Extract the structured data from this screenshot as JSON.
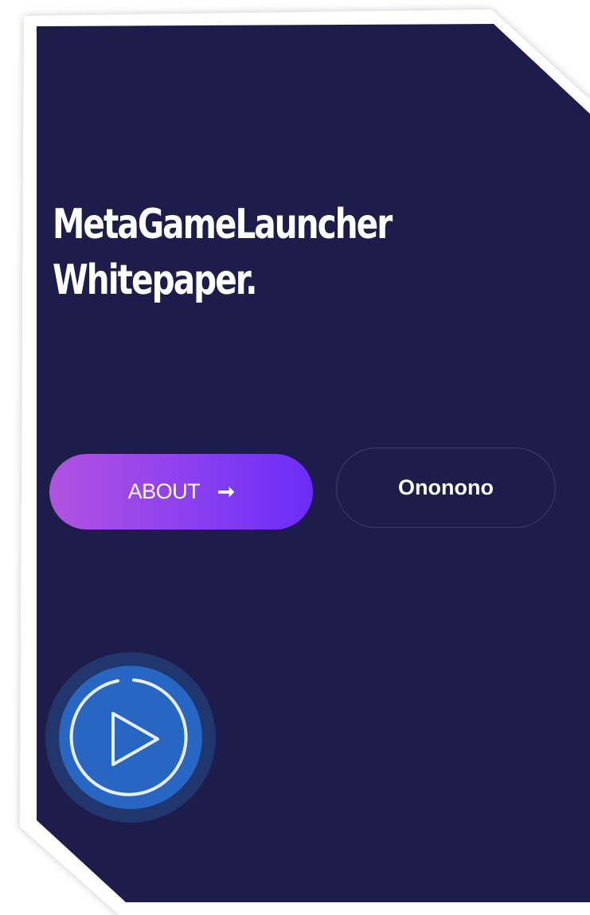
{
  "hero": {
    "title_line1": "MetaGameLauncher",
    "title_line2": "Whitepaper."
  },
  "buttons": {
    "about_label": "ABOUT",
    "about_arrow": "➞",
    "secondary_label": "Ononono"
  },
  "play_button": {
    "icon": "play-icon"
  },
  "colors": {
    "background": "#1e1c4a",
    "frame_border": "#ffffff",
    "about_gradient_start": "#b153e0",
    "about_gradient_end": "#6a2cf6",
    "secondary_border": "#3a3d70",
    "play_circle": "#2766c2",
    "play_outer_glow": "#22366e",
    "text": "#ffffff"
  }
}
